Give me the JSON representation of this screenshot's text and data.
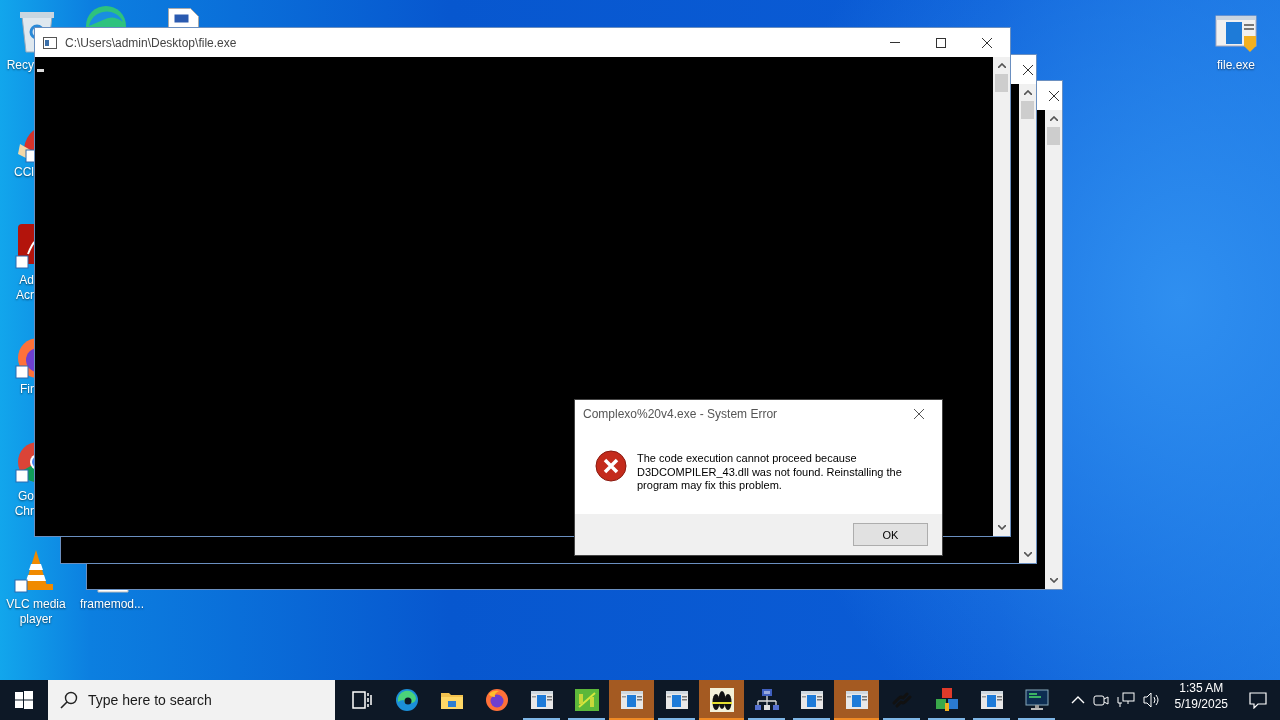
{
  "desktop": {
    "icons": [
      {
        "kind": "recycle",
        "label": "Recy"
      },
      {
        "kind": "ccleaner",
        "label": "CCl"
      },
      {
        "kind": "acrobat",
        "label": "Ad Acr"
      },
      {
        "kind": "firefox",
        "label": "Fir"
      },
      {
        "kind": "chrome",
        "label": "Go Chr"
      },
      {
        "kind": "vlc",
        "label": "VLC media player"
      },
      {
        "kind": "document",
        "label": "framemod..."
      },
      {
        "kind": "exe",
        "label": "file.exe"
      }
    ]
  },
  "console_windows": [
    {
      "kind": "covered"
    },
    {
      "kind": "covered"
    },
    {
      "kind": "front",
      "title": "C:\\Users\\admin\\Desktop\\file.exe"
    }
  ],
  "error_dialog": {
    "title": "Complexo%20v4.exe - System Error",
    "message": "The code execution cannot proceed because D3DCOMPILER_43.dll was not found. Reinstalling the program may fix this problem.",
    "button": "OK"
  },
  "taskbar": {
    "search": {
      "placeholder": "Type here to search"
    },
    "items": [
      {
        "kind": "task-view",
        "running": false,
        "highlighted": false
      },
      {
        "kind": "edge",
        "running": false,
        "highlighted": false
      },
      {
        "kind": "folder",
        "running": false,
        "highlighted": false
      },
      {
        "kind": "firefox",
        "running": false,
        "highlighted": false
      },
      {
        "kind": "window",
        "running": true,
        "highlighted": false
      },
      {
        "kind": "bh",
        "running": true,
        "highlighted": false
      },
      {
        "kind": "window",
        "running": true,
        "highlighted": true
      },
      {
        "kind": "window",
        "running": true,
        "highlighted": false
      },
      {
        "kind": "figures",
        "running": true,
        "highlighted": true
      },
      {
        "kind": "network-app",
        "running": true,
        "highlighted": false
      },
      {
        "kind": "window",
        "running": true,
        "highlighted": false
      },
      {
        "kind": "window",
        "running": true,
        "highlighted": true
      },
      {
        "kind": "chain",
        "running": true,
        "highlighted": false
      },
      {
        "kind": "boxes",
        "running": true,
        "highlighted": false
      },
      {
        "kind": "window",
        "running": true,
        "highlighted": false
      },
      {
        "kind": "terminal",
        "running": true,
        "highlighted": false
      }
    ],
    "clock": {
      "time": "1:35 AM",
      "date": "5/19/2025"
    }
  }
}
